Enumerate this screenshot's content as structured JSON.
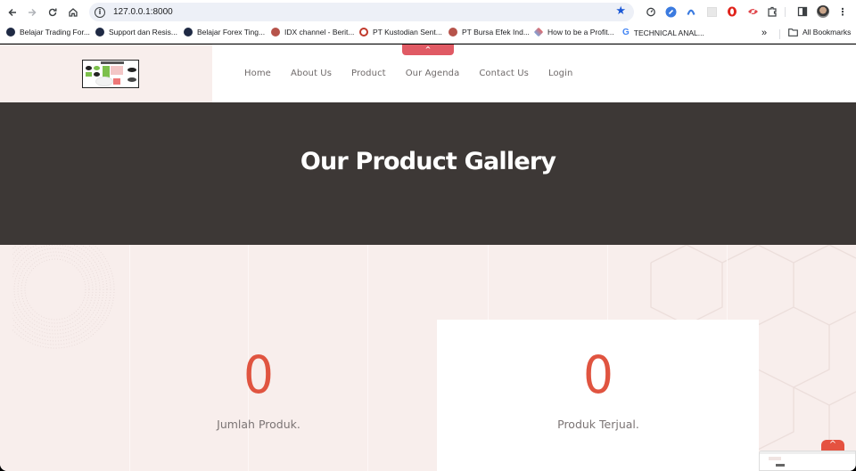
{
  "browser": {
    "url": "127.0.0.1:8000",
    "bookmarks": [
      {
        "label": "Belajar Trading For...",
        "icon": "forex-logo-icon"
      },
      {
        "label": "Support dan Resis...",
        "icon": "forex-logo-icon"
      },
      {
        "label": "Belajar Forex Ting...",
        "icon": "forex-logo-icon"
      },
      {
        "label": "IDX channel - Berit...",
        "icon": "idx-logo-icon"
      },
      {
        "label": "PT Kustodian Sent...",
        "icon": "ksei-logo-icon"
      },
      {
        "label": "PT Bursa Efek Ind...",
        "icon": "idx-logo-icon"
      },
      {
        "label": "How to be a Profit...",
        "icon": "diamond-icon"
      },
      {
        "label": "TECHNICAL ANAL...",
        "icon": "google-icon"
      }
    ],
    "overflow_label": "»",
    "all_bookmarks_label": "All Bookmarks"
  },
  "site": {
    "nav": [
      "Home",
      "About Us",
      "Product",
      "Our Agenda",
      "Contact Us",
      "Login"
    ],
    "scroll_tab_icon": "^",
    "hero_title": "Our Product Gallery",
    "stats": [
      {
        "value": "0",
        "label": "Jumlah Produk."
      },
      {
        "value": "0",
        "label": "Produk Terjual."
      }
    ],
    "back_to_top_icon": "^"
  },
  "colors": {
    "accent": "#e05440",
    "hero_bg": "#3d3836",
    "page_bg": "#f8eeec"
  }
}
